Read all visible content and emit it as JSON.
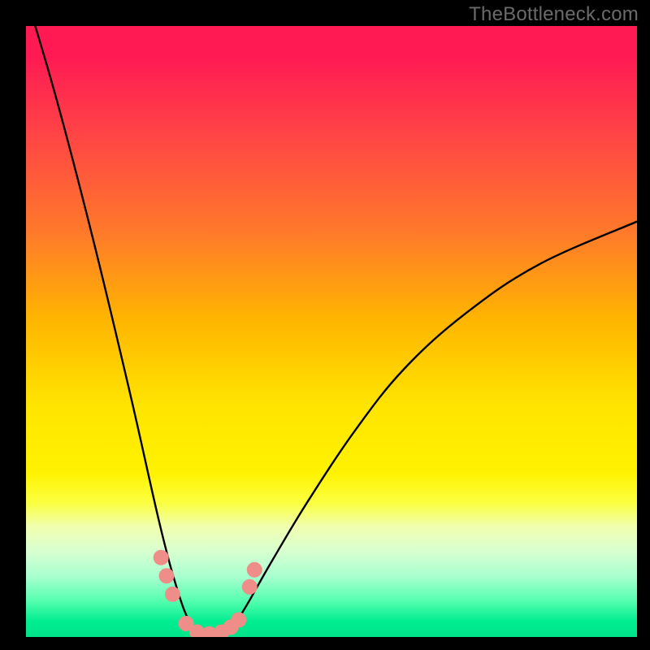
{
  "watermark": "TheBottleneck.com",
  "chart_data": {
    "type": "line",
    "title": "",
    "xlabel": "",
    "ylabel": "",
    "xlim": [
      0,
      100
    ],
    "ylim": [
      0,
      100
    ],
    "series": [
      {
        "name": "bottleneck-curve",
        "x": [
          0,
          5,
          11,
          17,
          22,
          25,
          27,
          28.5,
          30,
          32,
          34,
          36,
          40,
          46,
          54,
          62,
          72,
          84,
          100
        ],
        "y": [
          105,
          88,
          65,
          40,
          18,
          7,
          2,
          0,
          0,
          0,
          2,
          5,
          12,
          22,
          34,
          44,
          53,
          61,
          68
        ]
      }
    ],
    "markers": [
      {
        "name": "marker-dot",
        "x": 22.1,
        "y": 13.0
      },
      {
        "name": "marker-dot",
        "x": 23.0,
        "y": 10.0
      },
      {
        "name": "marker-dot",
        "x": 24.0,
        "y": 7.0
      },
      {
        "name": "marker-dot",
        "x": 26.2,
        "y": 2.2
      },
      {
        "name": "marker-dot",
        "x": 28.0,
        "y": 0.8
      },
      {
        "name": "marker-dot",
        "x": 30.0,
        "y": 0.5
      },
      {
        "name": "marker-dot",
        "x": 32.0,
        "y": 0.8
      },
      {
        "name": "marker-dot",
        "x": 33.5,
        "y": 1.6
      },
      {
        "name": "marker-dot",
        "x": 34.8,
        "y": 2.8
      },
      {
        "name": "marker-dot",
        "x": 36.6,
        "y": 8.2
      },
      {
        "name": "marker-dot",
        "x": 37.4,
        "y": 11.0
      }
    ],
    "colors": {
      "curve": "#000000",
      "marker": "#ef8d89"
    }
  }
}
